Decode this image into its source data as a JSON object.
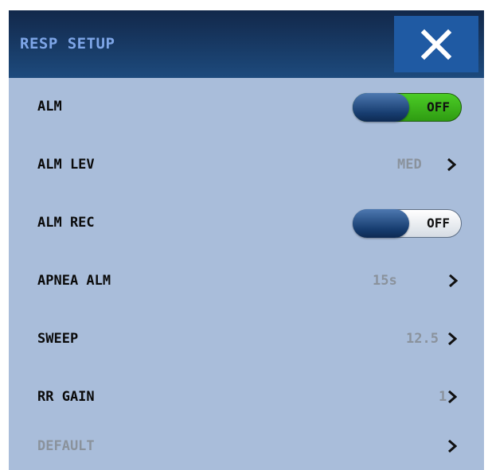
{
  "header": {
    "title": "RESP SETUP",
    "close_icon": "close-icon"
  },
  "rows": [
    {
      "label": "ALM",
      "control": "toggle",
      "value": "OFF",
      "accent": "#3fbf1f"
    },
    {
      "label": "ALM LEV",
      "control": "select",
      "value": "MED"
    },
    {
      "label": "ALM REC",
      "control": "toggle",
      "value": "OFF",
      "accent": "#ffffff"
    },
    {
      "label": "APNEA ALM",
      "control": "select",
      "value": "15s"
    },
    {
      "label": "SWEEP",
      "control": "select",
      "value": "12.5"
    },
    {
      "label": "RR GAIN",
      "control": "select",
      "value": "1"
    },
    {
      "label": "DEFAULT",
      "control": "link",
      "value": "",
      "disabled": true
    }
  ],
  "colors": {
    "panel_bg": "#a9bdda",
    "header_bg": "#12284a",
    "title_text": "#7ea6e8",
    "close_button": "#1f5aa3"
  }
}
